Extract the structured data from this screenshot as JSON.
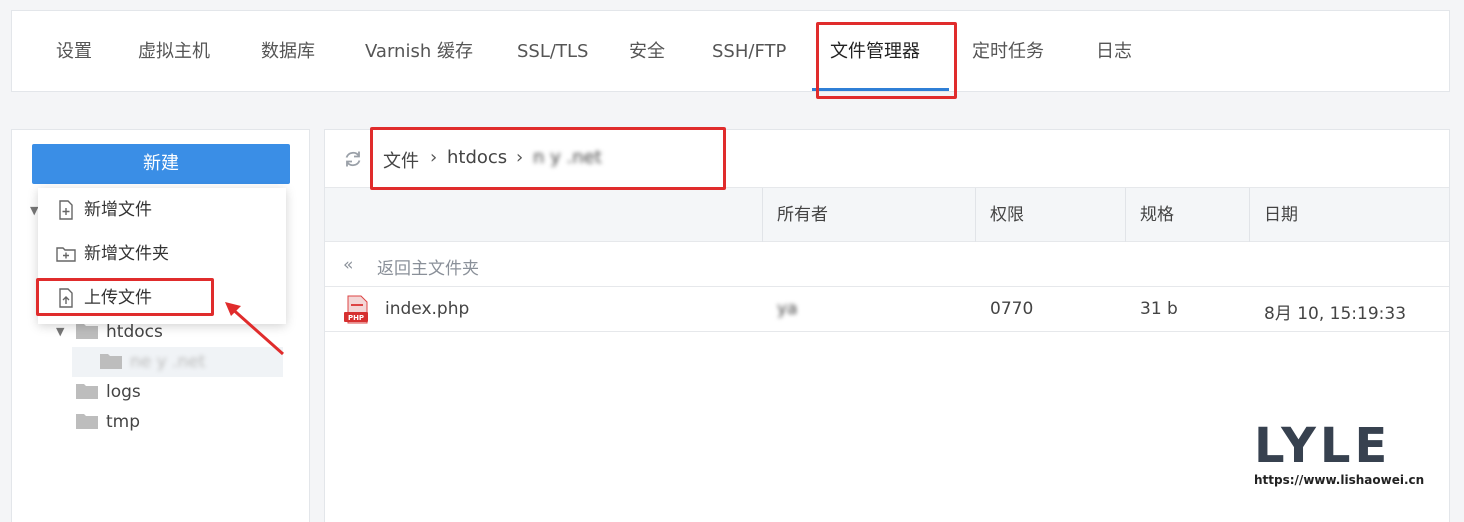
{
  "nav": {
    "tabs": [
      {
        "label": "设置"
      },
      {
        "label": "虚拟主机"
      },
      {
        "label": "数据库"
      },
      {
        "label": "Varnish 缓存"
      },
      {
        "label": "SSL/TLS"
      },
      {
        "label": "安全"
      },
      {
        "label": "SSH/FTP"
      },
      {
        "label": "文件管理器",
        "active": true
      },
      {
        "label": "定时任务"
      },
      {
        "label": "日志"
      }
    ],
    "accent_color": "#2f7fd6",
    "annotation_color": "#e02c2c"
  },
  "sidebar": {
    "new_button": "新建",
    "new_button_color": "#3a8ee6",
    "menu": [
      {
        "label": "新增文件",
        "icon": "file-plus-icon"
      },
      {
        "label": "新增文件夹",
        "icon": "folder-plus-icon"
      },
      {
        "label": "上传文件",
        "icon": "file-upload-icon"
      }
    ],
    "tree": [
      {
        "label": "htdocs",
        "expanded": true
      },
      {
        "label": "ne        y      .net",
        "selected": true
      },
      {
        "label": "logs"
      },
      {
        "label": "tmp"
      }
    ]
  },
  "breadcrumb": {
    "items": [
      "文件",
      "htdocs",
      "n        y   .net"
    ]
  },
  "table": {
    "headers": [
      "",
      "所有者",
      "权限",
      "规格",
      "日期"
    ],
    "back_label": "返回主文件夹",
    "rows": [
      {
        "name": "index.php",
        "owner": "                           ya",
        "perm": "0770",
        "size": "31 b",
        "date": "8月 10, 15:19:33",
        "icon_text": "PHP"
      }
    ]
  },
  "watermark": {
    "logo": "LYLE",
    "url": "https://www.lishaowei.cn"
  }
}
